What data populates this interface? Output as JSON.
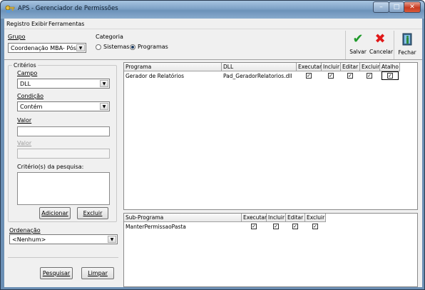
{
  "window": {
    "title": "APS - Gerenciador de Permissões",
    "controls": {
      "minimize": "–",
      "maximize": "□",
      "close": "✕"
    }
  },
  "menu": [
    "Registro",
    "Exibir",
    "Ferramentas"
  ],
  "filters": {
    "grupo_label": "Grupo",
    "grupo_value": "Coordenação MBA- Pós",
    "categoria_label": "Categoria",
    "categoria_options": [
      "Sistemas",
      "Programas"
    ],
    "categoria_selected": "Programas"
  },
  "toolbar": {
    "salvar": "Salvar",
    "cancelar": "Cancelar",
    "fechar": "Fechar",
    "colors": {
      "salvar": "#1f9a2a",
      "cancelar": "#e01818"
    }
  },
  "criterios": {
    "title": "Critérios",
    "campo_label": "Campo",
    "campo_value": "DLL",
    "condicao_label": "Condição",
    "condicao_value": "Contém",
    "valor_label": "Valor",
    "valor_value": "",
    "valor2_label": "Valor",
    "valor2_value": "",
    "pesquisa_label": "Critério(s) da pesquisa:",
    "adicionar": "Adicionar",
    "excluir": "Excluir"
  },
  "ordenacao": {
    "label": "Ordenação",
    "value": "<Nenhum>"
  },
  "bottom_buttons": {
    "pesquisar": "Pesquisar",
    "limpar": "Limpar"
  },
  "programas_grid": {
    "columns": [
      "Programa",
      "DLL",
      "Executar",
      "Incluir",
      "Editar",
      "Excluir",
      "Atalho"
    ],
    "rows": [
      {
        "programa": "Gerador de Relatórios",
        "dll": "Pad_GeradorRelatorios.dll",
        "executar": true,
        "incluir": true,
        "editar": true,
        "excluir": true,
        "atalho": true
      }
    ]
  },
  "subprogramas_grid": {
    "columns": [
      "Sub-Programa",
      "Executar",
      "Incluir",
      "Editar",
      "Excluir"
    ],
    "rows": [
      {
        "subprograma": "ManterPermissaoPasta",
        "executar": true,
        "incluir": true,
        "editar": true,
        "excluir": true
      }
    ]
  }
}
